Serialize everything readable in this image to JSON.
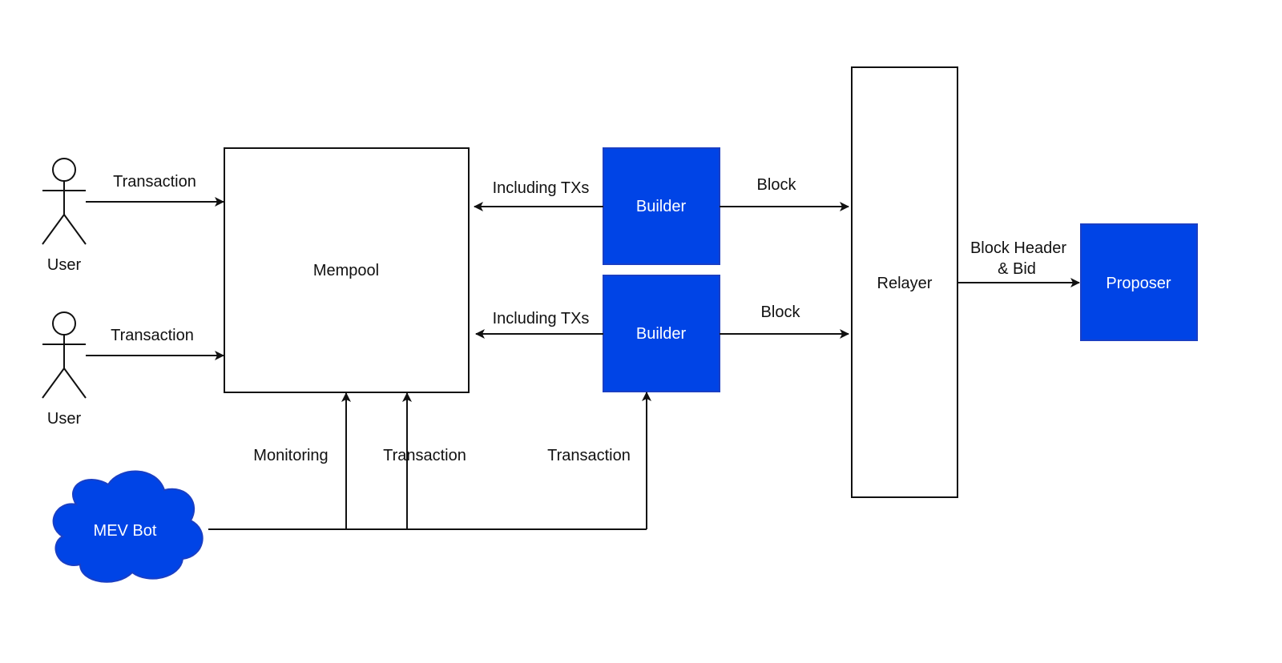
{
  "colors": {
    "node_fill": "#0044e6",
    "node_border": "#1a3fc4",
    "line": "#111111",
    "background": "#ffffff"
  },
  "actors": [
    {
      "label": "User"
    },
    {
      "label": "User"
    }
  ],
  "nodes": {
    "mempool": {
      "label": "Mempool"
    },
    "builder_1": {
      "label": "Builder"
    },
    "builder_2": {
      "label": "Builder"
    },
    "relayer": {
      "label": "Relayer"
    },
    "proposer": {
      "label": "Proposer"
    },
    "mev_bot": {
      "label": "MEV Bot"
    }
  },
  "edges": {
    "user1_to_mempool": {
      "label": "Transaction"
    },
    "user2_to_mempool": {
      "label": "Transaction"
    },
    "builder1_to_mempool": {
      "label": "Including TXs"
    },
    "builder2_to_mempool": {
      "label": "Including TXs"
    },
    "builder1_to_relayer": {
      "label": "Block"
    },
    "builder2_to_relayer": {
      "label": "Block"
    },
    "relayer_to_proposer": {
      "label_line1": "Block Header",
      "label_line2": "& Bid"
    },
    "mev_monitoring": {
      "label": "Monitoring"
    },
    "mev_to_mempool": {
      "label": "Transaction"
    },
    "mev_to_builder": {
      "label": "Transaction"
    }
  }
}
